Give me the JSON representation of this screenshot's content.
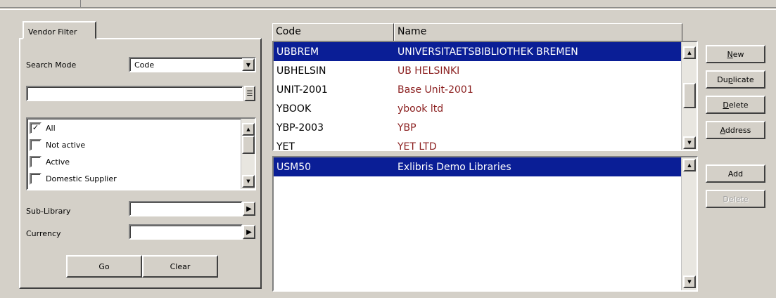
{
  "filter": {
    "tab_label": "Vendor Filter",
    "search_mode_label": "Search Mode",
    "search_mode_value": "Code",
    "search_text_value": "",
    "status_options": [
      {
        "label": "All",
        "checked": true
      },
      {
        "label": "Not active",
        "checked": false
      },
      {
        "label": "Active",
        "checked": false
      },
      {
        "label": "Domestic Supplier",
        "checked": false
      }
    ],
    "sub_library_label": "Sub-Library",
    "sub_library_value": "",
    "currency_label": "Currency",
    "currency_value": "",
    "go_label": "Go",
    "clear_label": "Clear"
  },
  "grid": {
    "col_code": "Code",
    "col_name": "Name",
    "vendors": [
      {
        "code": "UBBREM",
        "name": "UNIVERSITAETSBIBLIOTHEK BREMEN",
        "selected": true
      },
      {
        "code": "UBHELSIN",
        "name": "UB HELSINKI",
        "selected": false
      },
      {
        "code": "UNIT-2001",
        "name": "Base Unit-2001",
        "selected": false
      },
      {
        "code": "YBOOK",
        "name": "ybook ltd",
        "selected": false
      },
      {
        "code": "YBP-2003",
        "name": "YBP",
        "selected": false
      },
      {
        "code": "YET",
        "name": "YET LTD",
        "selected": false
      }
    ],
    "sublist": [
      {
        "code": "USM50",
        "name": "Exlibris Demo Libraries",
        "selected": true
      }
    ]
  },
  "actions": {
    "new_label": "New",
    "new_key": "N",
    "duplicate_label": "Duplicate",
    "duplicate_key": "p",
    "delete_label": "Delete",
    "delete_key": "D",
    "address_label": "Address",
    "address_key": "A",
    "add_label": "Add",
    "delete2_label": "Delete"
  },
  "colors": {
    "selection": "#0a1e96",
    "name_text": "#8b1f1f",
    "window_bg": "#d4d0c8"
  }
}
